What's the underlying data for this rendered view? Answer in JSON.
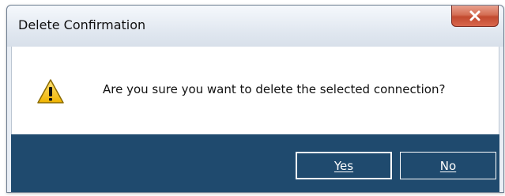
{
  "dialog": {
    "title": "Delete Confirmation",
    "icon": "warning-icon",
    "message": "Are you sure you want to delete the selected connection?",
    "buttons": {
      "yes": "Yes",
      "no": "No"
    },
    "close_icon": "close-icon",
    "colors": {
      "button_bar": "#1f4a6e",
      "close_button": "#c24a2f",
      "warning": "#f3c417"
    }
  }
}
